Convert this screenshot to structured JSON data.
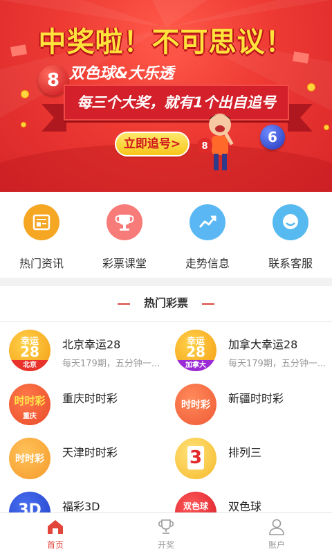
{
  "banner": {
    "title": "中奖啦！不可思议！",
    "subtitle": "双色球&大乐透",
    "ribbon": "每三个大奖，就有1个出自追号",
    "cta": "立即追号>",
    "ball_red": "8",
    "ball_blue": "6",
    "mascot_ball": "8",
    "colors": {
      "bg": "#e63a33",
      "title": "#ffe23b",
      "cta_bg": "#f8c51b"
    }
  },
  "quick_menu": [
    {
      "label": "热门资讯",
      "icon": "news-icon",
      "color": "#f5a623"
    },
    {
      "label": "彩票课堂",
      "icon": "trophy-icon",
      "color": "#f77b78"
    },
    {
      "label": "走势信息",
      "icon": "trend-icon",
      "color": "#5ab7f3"
    },
    {
      "label": "联系客服",
      "icon": "service-icon",
      "color": "#56b9f0"
    }
  ],
  "section": {
    "title": "热门彩票"
  },
  "lotteries": [
    {
      "name": "北京幸运28",
      "desc": "每天179期，五分钟一...",
      "icon_text": "幸运",
      "icon_num": "28",
      "icon_tag": "北京"
    },
    {
      "name": "加拿大幸运28",
      "desc": "每天179期，五分钟一...",
      "icon_text": "幸运",
      "icon_num": "28",
      "icon_tag": "加拿大"
    },
    {
      "name": "重庆时时彩",
      "desc": "",
      "icon_text": "时时彩",
      "icon_tag": "重庆"
    },
    {
      "name": "新疆时时彩",
      "desc": "",
      "icon_text": "时时彩"
    },
    {
      "name": "天津时时彩",
      "desc": "",
      "icon_text": "时时彩"
    },
    {
      "name": "排列三",
      "desc": "",
      "icon_text": "3"
    },
    {
      "name": "福彩3D",
      "desc": "",
      "icon_text": "3D"
    },
    {
      "name": "双色球",
      "desc": "",
      "icon_text": "双色球"
    }
  ],
  "tabbar": [
    {
      "label": "首页",
      "icon": "home-icon",
      "active": true
    },
    {
      "label": "开奖",
      "icon": "trophy-icon",
      "active": false
    },
    {
      "label": "账户",
      "icon": "user-icon",
      "active": false
    }
  ]
}
